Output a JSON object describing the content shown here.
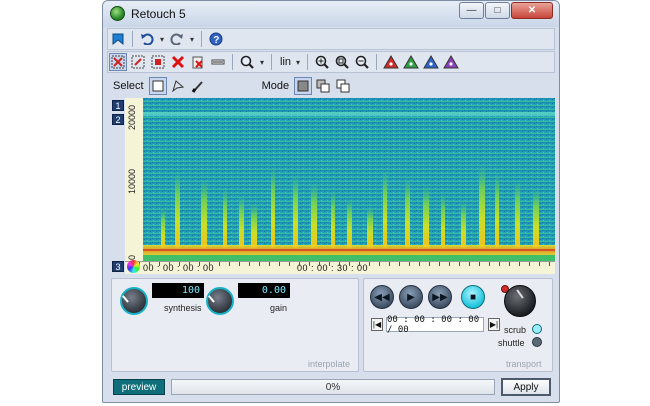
{
  "window": {
    "title": "Retouch 5",
    "minimize": "—",
    "maximize": "□",
    "close": "✕"
  },
  "toolbar1": {
    "icons": [
      "bookmark-icon",
      "undo-icon",
      "undo-dropdown-icon",
      "redo-icon",
      "redo-dropdown-icon",
      "help-icon"
    ]
  },
  "toolbar2": {
    "zoom_dropdown": "▾",
    "scale": "lin",
    "scale_dropdown": "▾",
    "colors": {
      "red": "#d12b2b",
      "green": "#2fa043",
      "blue": "#2e63c9",
      "purple": "#8a3fb8"
    }
  },
  "toolbar3": {
    "select_label": "Select",
    "mode_label": "Mode"
  },
  "tracks": {
    "track1": "1",
    "track2": "2",
    "track3": "3"
  },
  "yaxis": {
    "ticks": [
      "20000",
      "10000",
      "0"
    ]
  },
  "timebar": {
    "start": "00 : 00 : 00 : 00",
    "mid": "00 : 00 : 30 : 00"
  },
  "synthesis": {
    "value": "100",
    "label": "synthesis"
  },
  "gain": {
    "value": "0.00",
    "label": "gain"
  },
  "interpolate_label": "interpolate",
  "transport": {
    "rewind": "◀◀",
    "play": "▶",
    "forward": "▶▶",
    "stop": "■",
    "timecode": "00 : 00 : 00 : 00 / 00",
    "start": "|◀",
    "end": "▶|",
    "scrub": "scrub",
    "shuttle": "shuttle",
    "label": "transport"
  },
  "bottom": {
    "preview": "preview",
    "progress": "0%",
    "progress_value": 0,
    "apply": "Apply"
  }
}
